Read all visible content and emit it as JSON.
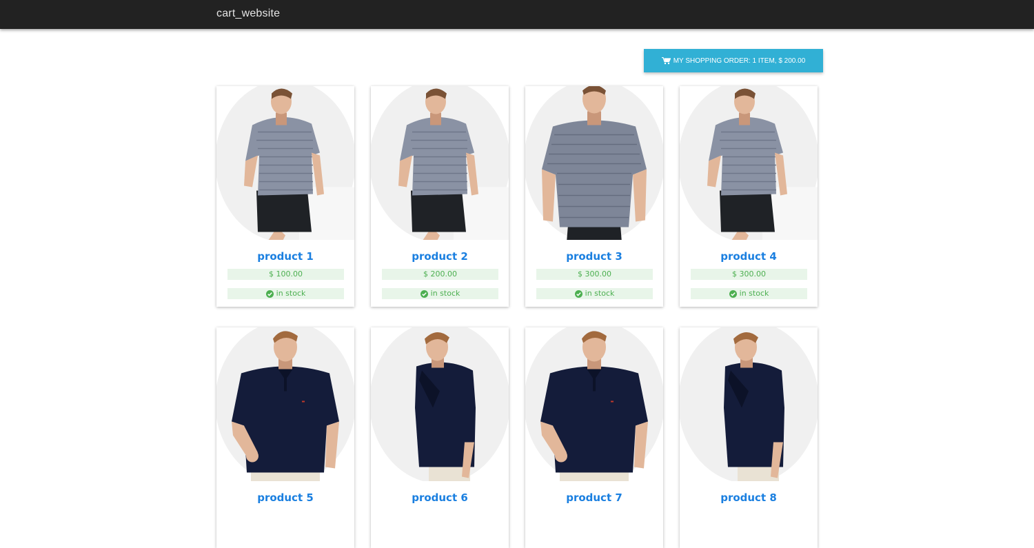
{
  "navbar": {
    "brand": "cart_website"
  },
  "cart": {
    "label": "MY SHOPPING ORDER: 1 ITEM, $ 200.00",
    "icon": "shopping-cart-icon",
    "color": "#31b0d5"
  },
  "colors": {
    "navbar": "#222222",
    "title": "#1a7fe0",
    "badge_bg": "#e8f5e9",
    "badge_text": "#4caf50"
  },
  "products": [
    {
      "name": "product 1",
      "price": "$ 100.00",
      "stock": "in stock",
      "image": "striped-tee-leaning"
    },
    {
      "name": "product 2",
      "price": "$ 200.00",
      "stock": "in stock",
      "image": "striped-tee-leaning"
    },
    {
      "name": "product 3",
      "price": "$ 300.00",
      "stock": "in stock",
      "image": "striped-tee-front"
    },
    {
      "name": "product 4",
      "price": "$ 300.00",
      "stock": "in stock",
      "image": "striped-tee-leaning"
    },
    {
      "name": "product 5",
      "price": "",
      "stock": "",
      "image": "navy-polo-front"
    },
    {
      "name": "product 6",
      "price": "",
      "stock": "",
      "image": "navy-polo-side"
    },
    {
      "name": "product 7",
      "price": "",
      "stock": "",
      "image": "navy-polo-front"
    },
    {
      "name": "product 8",
      "price": "",
      "stock": "",
      "image": "navy-polo-side"
    }
  ]
}
